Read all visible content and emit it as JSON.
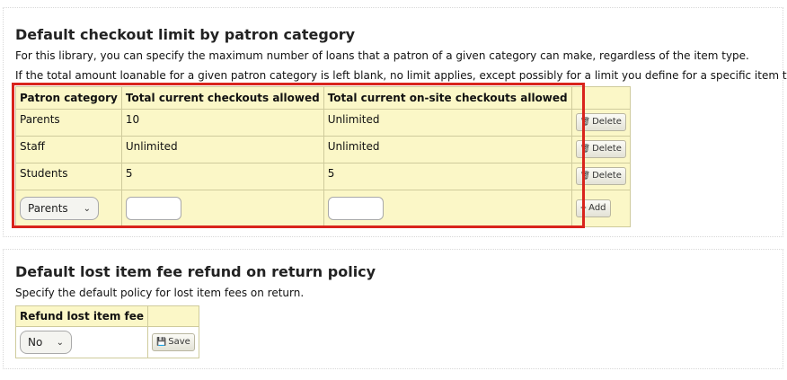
{
  "section1": {
    "title": "Default checkout limit by patron category",
    "desc1": "For this library, you can specify the maximum number of loans that a patron of a given category can make, regardless of the item type.",
    "desc2": "If the total amount loanable for a given patron category is left blank, no limit applies, except possibly for a limit you define for a specific item type.",
    "headers": [
      "Patron category",
      "Total current checkouts allowed",
      "Total current on-site checkouts allowed",
      ""
    ],
    "rows": [
      {
        "category": "Parents",
        "checkouts": "10",
        "onsite": "Unlimited",
        "action": "Delete"
      },
      {
        "category": "Staff",
        "checkouts": "Unlimited",
        "onsite": "Unlimited",
        "action": "Delete"
      },
      {
        "category": "Students",
        "checkouts": "5",
        "onsite": "5",
        "action": "Delete"
      }
    ],
    "add_row": {
      "category_selected": "Parents",
      "checkouts_value": "",
      "onsite_value": "",
      "add_label": "Add"
    },
    "highlight_color": "#d9241c"
  },
  "section2": {
    "title": "Default lost item fee refund on return policy",
    "desc": "Specify the default policy for lost item fees on return.",
    "header": "Refund lost item fee",
    "selected": "No",
    "save_label": "Save"
  },
  "icons": {
    "delete": "trash-icon",
    "add": "plus-icon",
    "save": "floppy-icon",
    "dropdown": "chevron-down-icon"
  }
}
